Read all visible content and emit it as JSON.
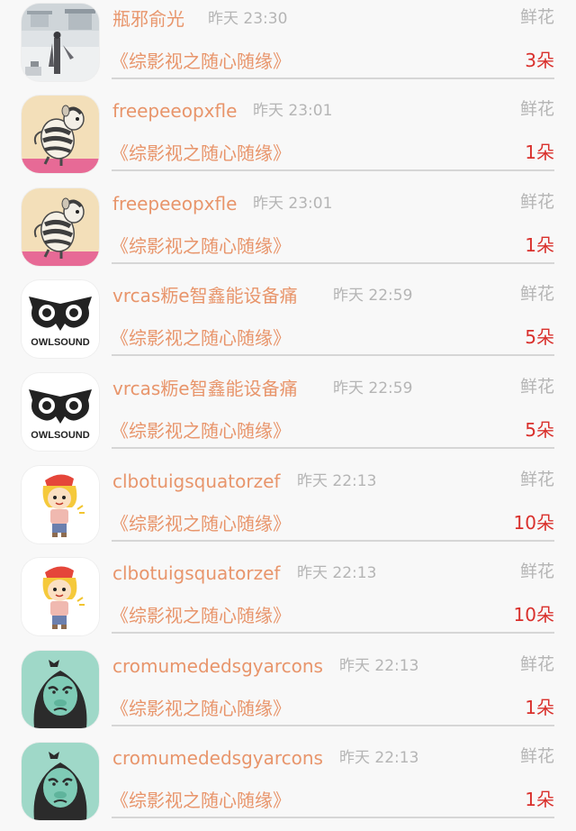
{
  "gifts": [
    {
      "name": "瓶邪俞光",
      "time": "昨天 23:30",
      "type": "鲜花",
      "book": "《综影视之随心随缘》",
      "count": "3朵",
      "avatar_icon": "snow-palace-figure-avatar"
    },
    {
      "name": "freepeeopxfle",
      "time": "昨天 23:01",
      "type": "鲜花",
      "book": "《综影视之随心随缘》",
      "count": "1朵",
      "avatar_icon": "hamster-avatar"
    },
    {
      "name": "freepeeopxfle",
      "time": "昨天 23:01",
      "type": "鲜花",
      "book": "《综影视之随心随缘》",
      "count": "1朵",
      "avatar_icon": "hamster-avatar"
    },
    {
      "name": "vrcas粝e智鑫能设备痛",
      "time": "昨天 22:59",
      "type": "鲜花",
      "book": "《综影视之随心随缘》",
      "count": "5朵",
      "avatar_icon": "owlsound-logo-avatar",
      "avatar_text": "OWLSOUND"
    },
    {
      "name": "vrcas粝e智鑫能设备痛",
      "time": "昨天 22:59",
      "type": "鲜花",
      "book": "《综影视之随心随缘》",
      "count": "5朵",
      "avatar_icon": "owlsound-logo-avatar",
      "avatar_text": "OWLSOUND"
    },
    {
      "name": "clbotuigsquatorzef",
      "time": "昨天 22:13",
      "type": "鲜花",
      "book": "《综影视之随心随缘》",
      "count": "10朵",
      "avatar_icon": "cartoon-kid-avatar"
    },
    {
      "name": "clbotuigsquatorzef",
      "time": "昨天 22:13",
      "type": "鲜花",
      "book": "《综影视之随心随缘》",
      "count": "10朵",
      "avatar_icon": "cartoon-kid-avatar"
    },
    {
      "name": "cromumededsgyarcons",
      "time": "昨天 22:13",
      "type": "鲜花",
      "book": "《综影视之随心随缘》",
      "count": "1朵",
      "avatar_icon": "gorilla-avatar"
    },
    {
      "name": "cromumededsgyarcons",
      "time": "昨天 22:13",
      "type": "鲜花",
      "book": "《综影视之随心随缘》",
      "count": "1朵",
      "avatar_icon": "gorilla-avatar"
    }
  ]
}
